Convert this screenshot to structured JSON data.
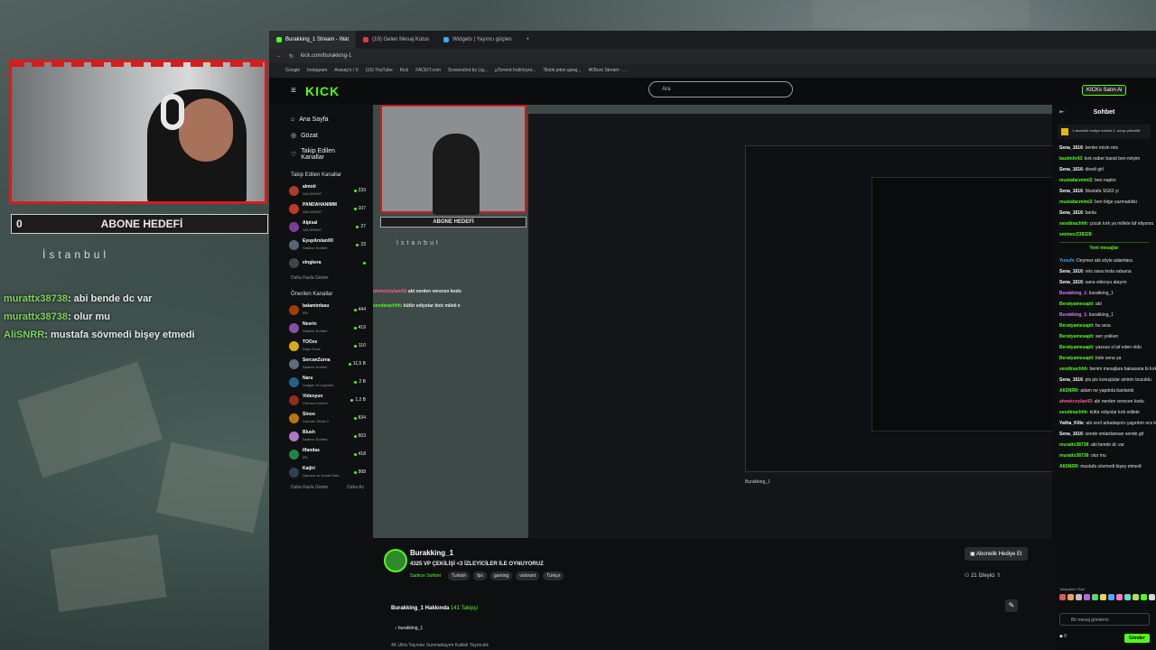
{
  "overlay": {
    "goal_count": "0",
    "goal_label": "ABONE HEDEFİ",
    "city": "İstanbul",
    "chat": [
      {
        "user": "murattx38738",
        "text": ": abi bende dc var"
      },
      {
        "user": "murattx38738",
        "text": ": olur mu"
      },
      {
        "user": "AliSNRR",
        "text": ": mustafa sövmedi bişey etmedi"
      }
    ]
  },
  "browser": {
    "tabs": [
      "Burakking_1 Stream - Wat",
      "(19) Gelen Mesaj Kutus",
      "Widgets | Yayıncı güçlen"
    ],
    "url": "kick.com/burakking-1",
    "bookmarks": [
      "Google",
      "Instagram",
      "Arasay's / X",
      "(16) YouTube",
      "Kick",
      "FACEIT.com",
      "Screenshot by Lig...",
      "µTorrent İndiriciyor...",
      "Tiktok jeton garaj...",
      "4KBuro Stream - ..."
    ]
  },
  "kick": {
    "logo": "KICK",
    "search_placeholder": "Ara",
    "kicks_button": "KICKs Satın Al",
    "nav": [
      {
        "label": "Ana Sayfa",
        "icon": "home-icon"
      },
      {
        "label": "Gözat",
        "icon": "compass-icon"
      },
      {
        "label": "Takip Edilen Kanallar",
        "icon": "heart-icon"
      }
    ],
    "followed_title": "Takip Edilen Kanallar",
    "followed": [
      {
        "name": "almoti",
        "game": "VALORANT",
        "viewers": "233",
        "color": "#b03a2e"
      },
      {
        "name": "PANDAHANIMM",
        "game": "VALORANT",
        "viewers": "107",
        "color": "#c0392b"
      },
      {
        "name": "Alpisal",
        "game": "VALORANT",
        "viewers": "27",
        "color": "#7d3c98"
      },
      {
        "name": "EyupArslanXII",
        "game": "Sadece Sohbet",
        "viewers": "23",
        "color": "#566573"
      },
      {
        "name": "elngkera",
        "game": "",
        "viewers": "",
        "color": "#444444"
      }
    ],
    "followed_more": "Daha Fazla Göster",
    "suggested_title": "Önerilen Kanallar",
    "suggested": [
      {
        "name": "balamirdasu",
        "game": "IRL",
        "viewers": "444",
        "color": "#a04000"
      },
      {
        "name": "Nesrin",
        "game": "Sadece Sohbet",
        "viewers": "419",
        "color": "#884ea0"
      },
      {
        "name": "TOOxe",
        "game": "Days Gone",
        "viewers": "110",
        "color": "#d4ac0d"
      },
      {
        "name": "SercanZurna",
        "game": "Sadece Sohbet",
        "viewers": "11,5 B",
        "color": "#5d6d7e"
      },
      {
        "name": "Naru",
        "game": "League of Legends",
        "viewers": "2 B",
        "color": "#1f618d"
      },
      {
        "name": "Videoyun",
        "game": "Crimson Desert",
        "viewers": "1,2 B",
        "color": "#922b21"
      },
      {
        "name": "Sinoo",
        "game": "Counter-Strike 2",
        "viewers": "834",
        "color": "#b9770e"
      },
      {
        "name": "Blush",
        "game": "Sadece Sohbet",
        "viewers": "603",
        "color": "#af7ac5"
      },
      {
        "name": "ilfandas",
        "game": "IRL",
        "viewers": "418",
        "color": "#1e8449"
      },
      {
        "name": "Kaijiri",
        "game": "Oyunlar ve Dosta Saril...",
        "viewers": "908",
        "color": "#2e4053"
      }
    ],
    "suggested_more": "Daha Fazla Göster",
    "suggested_less": "Daha Az",
    "stream": {
      "name": "Burakking_1",
      "title": "4325 VP ÇEKİLİŞİ <3 İZLEYİCİLER İLE OYNUYORUZ",
      "category": "Sadece Sohbet",
      "tags": [
        "Turkish",
        "fps",
        "gaming",
        "valorant",
        "Türkçe"
      ],
      "subscribe_button": "Abonelik Hediye Et",
      "viewers": "21 İzleyici",
      "about": "Burakking_1 Hakkında",
      "followers": "141 Takipçi",
      "social": "burakking_1",
      "description": "4K Ultra Yayınlar Sunmaktayım Kaliteli Yaymcılık"
    },
    "player_chat": [
      {
        "user": "ahmetceylan43",
        "text": ": abi nerden verecen kodu"
      },
      {
        "user": "seodinachhh",
        "text": ": küfür ediyolar kick mileti e"
      }
    ]
  },
  "chat": {
    "title": "Sohbet",
    "pinned": "1 abonelik hediye ederek 1. sırayı yükseltti",
    "new_messages": "Yeni mesajlar",
    "messages_before": [
      {
        "user": "Sena_1616",
        "text": ": benler misin reis",
        "color": "#ffffff"
      },
      {
        "user": "bastinfo43",
        "text": ": kırk naber barati ben miiyim",
        "color": "#53fc18"
      },
      {
        "user": "Sena_1616",
        "text": ": diredi girl",
        "color": "#ffffff"
      },
      {
        "user": "mustafacmimi2",
        "text": ": ben naptın",
        "color": "#53fc18"
      },
      {
        "user": "Sena_1616",
        "text": ": Mustafa SG62 yi",
        "color": "#ffffff"
      },
      {
        "user": "mustafacmimi2",
        "text": ": ben bilge yazmadıkki",
        "color": "#53fc18"
      },
      {
        "user": "Sena_1616",
        "text": ": banla",
        "color": "#ffffff"
      },
      {
        "user": "seodinachhh",
        "text": ": çocuk kırk ya millete laf etiyorsu",
        "color": "#53fc18"
      },
      {
        "user": "smimoc538328",
        "text": ":",
        "color": "#53fc18"
      }
    ],
    "messages_after": [
      {
        "user": "Yusufx",
        "text": ": Deymez abi söyle adamlara",
        "color": "#3fa9f5"
      },
      {
        "user": "Sena_1616",
        "text": ": reis sana insta salsana",
        "color": "#ffffff"
      },
      {
        "user": "Sena_1616",
        "text": ": sana videoyu atayım",
        "color": "#ffffff"
      },
      {
        "user": "Burakking_1",
        "text": ": burakking_1",
        "color": "#d17dff"
      },
      {
        "user": "Beratyamesapti",
        "text": ": abi",
        "color": "#53fc18"
      },
      {
        "user": "Burakking_1",
        "text": ": burakking_1",
        "color": "#d17dff"
      },
      {
        "user": "Beratyamesapti",
        "text": ": bu arsa",
        "color": "#53fc18"
      },
      {
        "user": "Beratyamesapti",
        "text": ": sen yokken",
        "color": "#53fc18"
      },
      {
        "user": "Beratyamesapti",
        "text": ": yazuux si laf eden oldu",
        "color": "#53fc18"
      },
      {
        "user": "Beratyamesapti",
        "text": ": bide sena ya",
        "color": "#53fc18"
      },
      {
        "user": "seodinachhh",
        "text": ": benim mesajlara bakasana bi kırk bende mesaj ettim",
        "color": "#53fc18"
      },
      {
        "user": "Sena_1616",
        "text": ": pis pis konuşlular sinirim bozuldu",
        "color": "#ffffff"
      },
      {
        "user": "AliSNRR",
        "text": ": adam ne yapdıda banlandı",
        "color": "#53fc18"
      },
      {
        "user": "ahmetceylan43",
        "text": ": abi nerden verecen kodu",
        "color": "#ff5c8a"
      },
      {
        "user": "seodinachhh",
        "text": ": küfür ediyolar kırk millete",
        "color": "#53fc18"
      },
      {
        "user": "Yatha_Kille",
        "text": ": abi sınıf arkadaşımı çagırdım ocs katılsa olurmu",
        "color": "#ffffff"
      },
      {
        "user": "Sena_1616",
        "text": ": sende ontardansan sende git",
        "color": "#ffffff"
      },
      {
        "user": "murattx38738",
        "text": ": abi bende dc var",
        "color": "#53fc18"
      },
      {
        "user": "murattx38738",
        "text": ": olur mu",
        "color": "#53fc18"
      },
      {
        "user": "AliSNRR",
        "text": ": mustafa sövmedi bişey etmedi",
        "color": "#53fc18"
      }
    ],
    "emotes_title": "Takipçilere Özel",
    "emote_colors": [
      "#d95b5b",
      "#e6a35a",
      "#c0c0c0",
      "#b06ad8",
      "#5ad86a",
      "#e5d85a",
      "#58a6ff",
      "#ff7ab6",
      "#6ad8c8",
      "#a8e35a",
      "#53fc18",
      "#d8d8d8",
      "#f5a623"
    ],
    "input_placeholder": "Bir mesaj gönderin",
    "send_button": "Gönder",
    "points": "0"
  }
}
